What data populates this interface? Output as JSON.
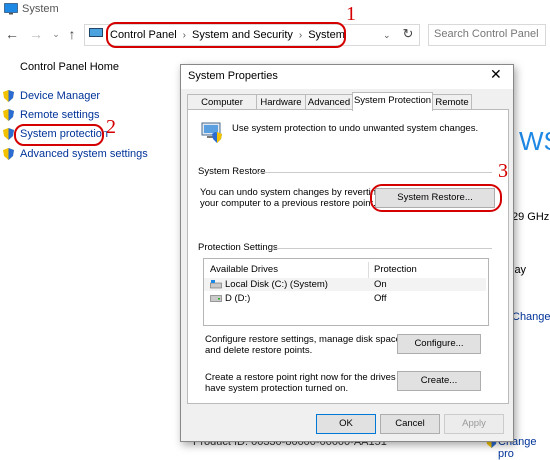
{
  "window": {
    "title": "System"
  },
  "address_bar": {
    "breadcrumbs": [
      "Control Panel",
      "System and Security",
      "System"
    ],
    "search_placeholder": "Search Control Panel"
  },
  "left_nav": {
    "home": "Control Panel Home",
    "items": [
      {
        "label": "Device Manager"
      },
      {
        "label": "Remote settings"
      },
      {
        "label": "System protection"
      },
      {
        "label": "Advanced system settings"
      }
    ]
  },
  "background": {
    "ws_text": "WS",
    "ghz_text": "29 GHz",
    "lay_text": "lay",
    "change_text": "Change",
    "product_id": "Product ID: 00330-80000-00000-AA151",
    "change_product": "Change pro"
  },
  "annotations": {
    "n1": "1",
    "n2": "2",
    "n3": "3",
    "color": "#d40000"
  },
  "dialog": {
    "title": "System Properties",
    "close": "✕",
    "tabs": [
      "Computer Name",
      "Hardware",
      "Advanced",
      "System Protection",
      "Remote"
    ],
    "intro": "Use system protection to undo unwanted system changes.",
    "restore_group": "System Restore",
    "restore_text_1": "You can undo system changes by reverting",
    "restore_text_2": "your computer to a previous restore point.",
    "restore_button": "System Restore...",
    "protection_group": "Protection Settings",
    "drives_header": {
      "col1": "Available Drives",
      "col2": "Protection"
    },
    "drives": [
      {
        "name": "Local Disk (C:) (System)",
        "protection": "On"
      },
      {
        "name": "D (D:)",
        "protection": "Off"
      }
    ],
    "configure_text_1": "Configure restore settings, manage disk space,",
    "configure_text_2": "and delete restore points.",
    "configure_button": "Configure...",
    "create_text_1": "Create a restore point right now for the drives that",
    "create_text_2": "have system protection turned on.",
    "create_button": "Create...",
    "ok": "OK",
    "cancel": "Cancel",
    "apply": "Apply"
  }
}
